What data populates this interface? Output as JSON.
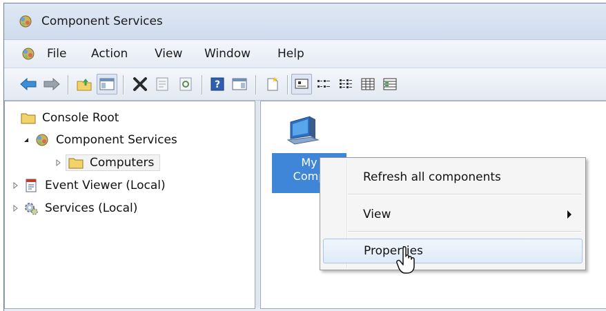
{
  "window": {
    "title": "Component Services"
  },
  "menu": [
    "File",
    "Action",
    "View",
    "Window",
    "Help"
  ],
  "toolbar": {
    "icons": [
      "back-arrow-icon",
      "forward-arrow-icon",
      "up-folder-icon",
      "show-hide-tree-icon",
      "delete-icon",
      "properties-icon",
      "refresh-icon",
      "help-icon",
      "show-hide-action-pane-icon",
      "new-item-icon",
      "large-icons-view-icon",
      "small-icons-view-icon",
      "list-view-icon",
      "detail-view-icon",
      "status-view-icon"
    ]
  },
  "tree": {
    "root": "Console Root",
    "component_services": "Component Services",
    "computers": "Computers",
    "event_viewer": "Event Viewer (Local)",
    "services": "Services (Local)"
  },
  "content": {
    "item_label_line1": "My",
    "item_label_line2": "Comp"
  },
  "context_menu": {
    "refresh": "Refresh all components",
    "view": "View",
    "properties": "Properties"
  },
  "colors": {
    "selection_blue": "#3f86d9",
    "folder_yellow": "#f2d36b",
    "hover_border": "#a9c4e6"
  }
}
